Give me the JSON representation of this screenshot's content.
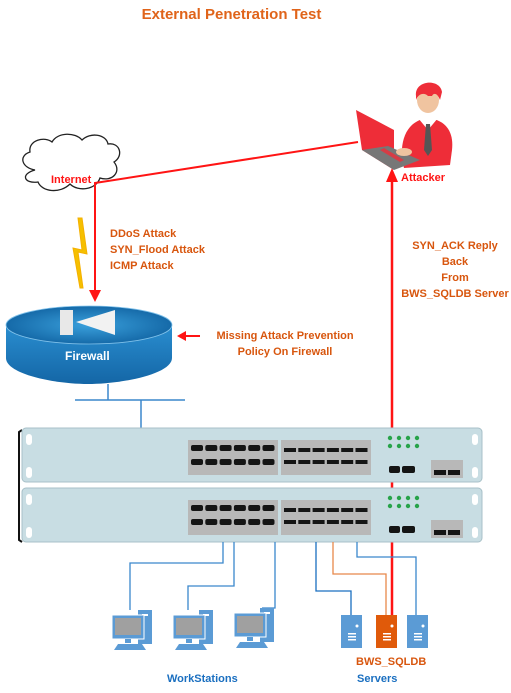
{
  "title": "External Penetration Test",
  "nodes": {
    "internet": {
      "label": "Internet",
      "icon": "cloud-icon"
    },
    "attacker": {
      "label": "Attacker",
      "icon": "hacker-laptop-icon"
    },
    "firewall": {
      "label": "Firewall",
      "icon": "firewall-icon"
    },
    "switch_stack": {
      "icon": "network-switch-icon",
      "units": 2
    },
    "workstations": {
      "label": "WorkStations",
      "count": 3,
      "icon": "desktop-computer-icon"
    },
    "servers": {
      "label_primary": "BWS_SQLDB",
      "label_secondary": "Servers",
      "count": 3,
      "highlighted_index": 1,
      "icon": "server-icon"
    }
  },
  "annotations": {
    "attacks": [
      "DDoS Attack",
      "SYN_Flood Attack",
      "ICMP Attack"
    ],
    "firewall_note": [
      "Missing Attack Prevention",
      "Policy On Firewall"
    ],
    "reply_note": [
      "SYN_ACK Reply Back",
      "From",
      "BWS_SQLDB Server"
    ]
  },
  "colors": {
    "title": "#e0641a",
    "annotation": "#d8560e",
    "attack_path": "#ff1414",
    "network_link": "#3a87cc",
    "highlight_server": "#e05a0a",
    "server": "#5b9bd5",
    "firewall": "#1a78b8",
    "switch_body": "#c8dde3",
    "lightning": "#f5c000"
  }
}
